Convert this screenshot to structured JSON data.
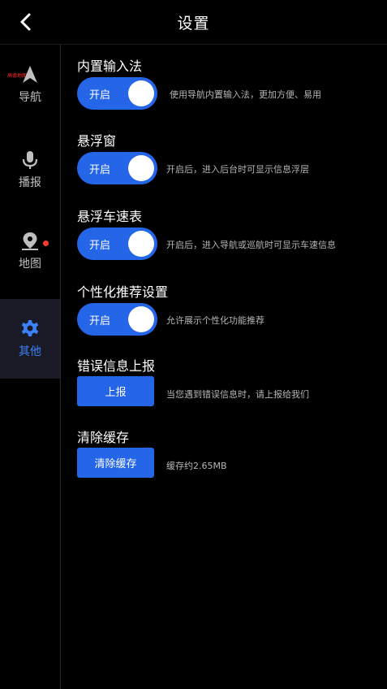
{
  "header": {
    "title": "设置"
  },
  "sidebar": {
    "tag": "高德地图",
    "items": [
      {
        "label": "导航",
        "icon": "navigation-arrow-icon"
      },
      {
        "label": "播报",
        "icon": "microphone-icon"
      },
      {
        "label": "地图",
        "icon": "map-pin-icon"
      },
      {
        "label": "其他",
        "icon": "gear-icon"
      }
    ]
  },
  "settings": [
    {
      "title": "内置输入法",
      "control": "开启",
      "desc": "使用导航内置输入法，更加方便、易用"
    },
    {
      "title": "悬浮窗",
      "control": "开启",
      "desc": "开启后，进入后台时可显示信息浮层"
    },
    {
      "title": "悬浮车速表",
      "control": "开启",
      "desc": "开启后，进入导航或巡航时可显示车速信息"
    },
    {
      "title": "个性化推荐设置",
      "control": "开启",
      "desc": "允许展示个性化功能推荐"
    },
    {
      "title": "错误信息上报",
      "control": "上报",
      "desc": "当您遇到错误信息时，请上报给我们"
    },
    {
      "title": "清除缓存",
      "control": "清除缓存",
      "desc": "缓存约2.65MB"
    }
  ],
  "colors": {
    "accent": "#2566e8",
    "active_text": "#3b82f6",
    "badge": "#ff3b30"
  }
}
